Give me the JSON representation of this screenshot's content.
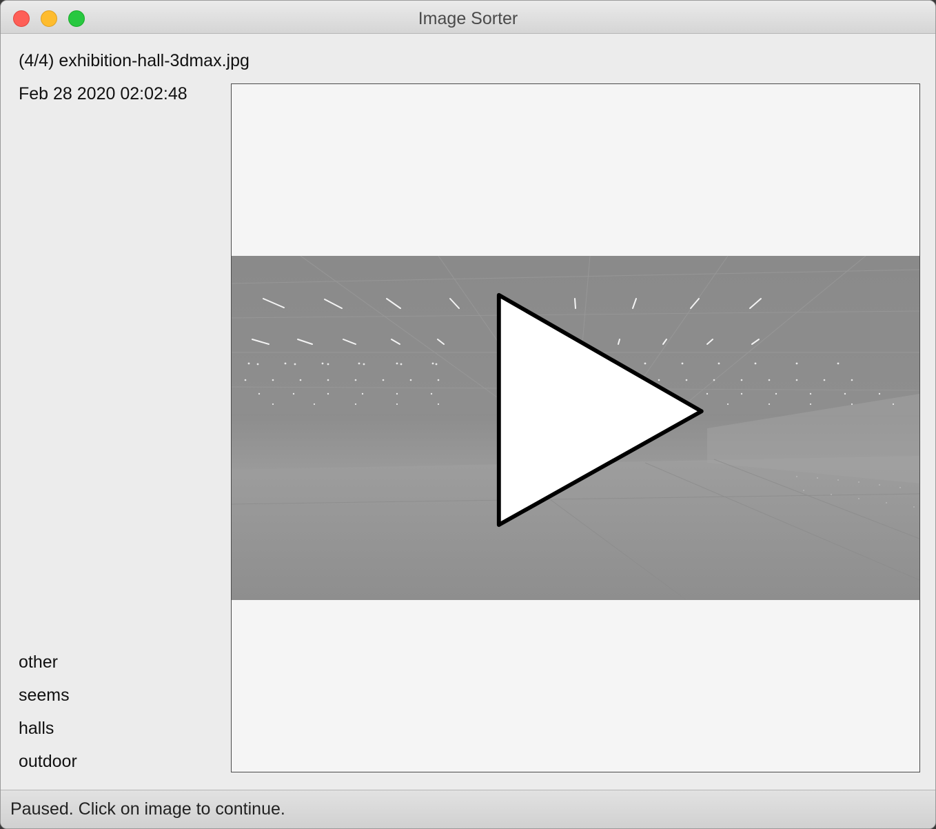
{
  "window": {
    "title": "Image Sorter"
  },
  "image_info": {
    "file_label": "(4/4) exhibition-hall-3dmax.jpg",
    "date_label": "Feb 28 2020 02:02:48"
  },
  "categories": [
    {
      "label": "other"
    },
    {
      "label": "seems"
    },
    {
      "label": "halls"
    },
    {
      "label": "outdoor"
    }
  ],
  "viewer": {
    "state_icon": "play-icon"
  },
  "status": {
    "text": "Paused. Click on image to continue."
  }
}
